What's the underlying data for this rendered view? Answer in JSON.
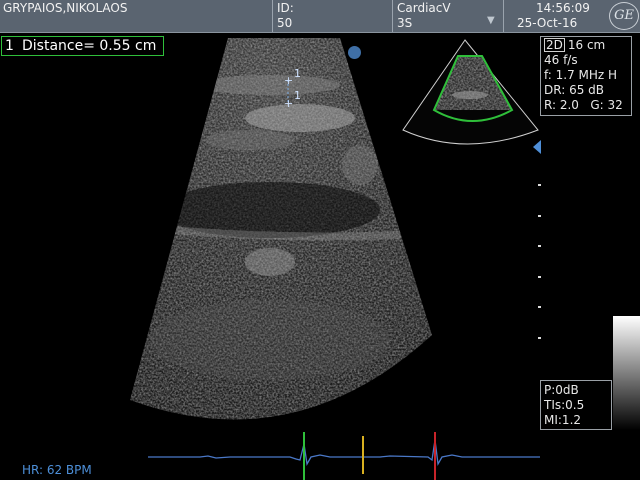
{
  "header": {
    "patient_name": "GRYPAIOS,NIKOLAOS",
    "id_label": "ID:",
    "id_value": "50",
    "preset": "CardiacV",
    "probe": "3S",
    "time": "14:56:09",
    "date": "25-Oct-16",
    "logo_text": "GE"
  },
  "measurement": {
    "index": "1",
    "label": "Distance=  0.55 cm",
    "caliper_label_top": "1",
    "caliper_label_bottom": "1"
  },
  "imaging_params": {
    "mode": "2D",
    "depth": "16 cm",
    "frame_rate": "46 f/s",
    "frequency": "f: 1.7 MHz H",
    "dynamic_range": "DR: 65 dB",
    "reject": "R: 2.0",
    "gain": "G: 32"
  },
  "safety": {
    "power": "P:0dB",
    "tis": "TIs:0.5",
    "mi": "MI:1.2"
  },
  "ecg": {
    "heart_rate": "HR: 62 BPM",
    "colors": {
      "trace": "#4a78c8",
      "marker_green": "#2fbf3a",
      "marker_yellow": "#d8b020",
      "marker_red": "#c8242a"
    }
  }
}
